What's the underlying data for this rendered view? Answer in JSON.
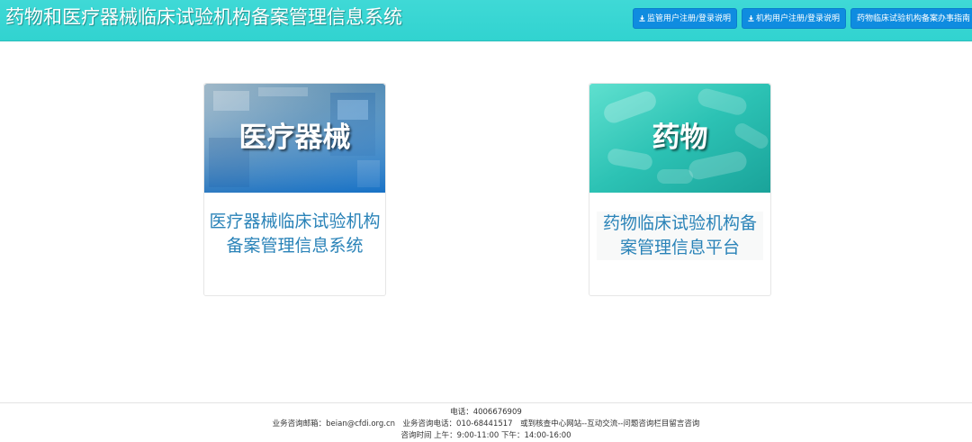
{
  "header": {
    "title": "药物和医疗器械临床试验机构备案管理信息系统",
    "buttons": [
      {
        "label": "监管用户注册/登录说明",
        "icon": "download-icon"
      },
      {
        "label": "机构用户注册/登录说明",
        "icon": "download-icon"
      },
      {
        "label": "药物临床试验机构备案办事指南"
      }
    ],
    "color": "#33d4d1",
    "button_color": "#0f8ce0"
  },
  "cards": [
    {
      "image_label": "医疗器械",
      "text": "医疗器械临床试验机构备案管理信息系统"
    },
    {
      "image_label": "药物",
      "text": "药物临床试验机构备案管理信息平台"
    }
  ],
  "footer": {
    "phone": "电话：4006676909",
    "consult": "业务咨询邮箱：beian@cfdi.org.cn　业务咨询电话：010-68441517　或到核查中心网站--互动交流--问题咨询栏目留言咨询",
    "hours": "咨询时间 上午：9:00-11:00 下午：14:00-16:00"
  },
  "accent_text_color": "#2a83b8"
}
